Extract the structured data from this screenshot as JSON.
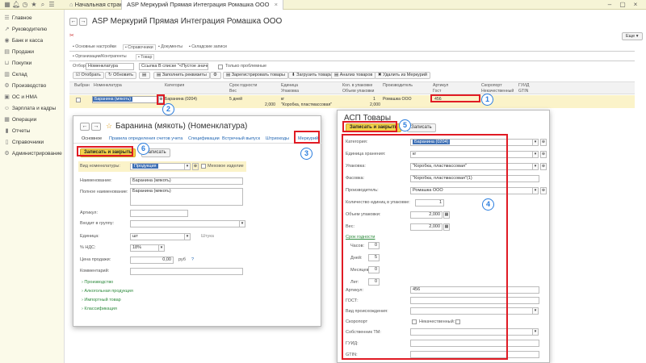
{
  "titlebar": {
    "tab_home": "Начальная страница",
    "tab_active": "ASP Меркурий Прямая Интеграция Ромашка ООО"
  },
  "sidebar": {
    "items": [
      {
        "label": "Главное",
        "icon": "menu-icon"
      },
      {
        "label": "Руководителю",
        "icon": "chart-icon"
      },
      {
        "label": "Банк и касса",
        "icon": "bank-icon"
      },
      {
        "label": "Продажи",
        "icon": "sales-icon"
      },
      {
        "label": "Покупки",
        "icon": "cart-icon"
      },
      {
        "label": "Склад",
        "icon": "warehouse-icon"
      },
      {
        "label": "Производство",
        "icon": "factory-icon"
      },
      {
        "label": "ОС и НМА",
        "icon": "assets-icon"
      },
      {
        "label": "Зарплата и кадры",
        "icon": "people-icon"
      },
      {
        "label": "Операции",
        "icon": "operations-icon"
      },
      {
        "label": "Отчеты",
        "icon": "reports-icon"
      },
      {
        "label": "Справочники",
        "icon": "catalogs-icon"
      },
      {
        "label": "Администрирование",
        "icon": "gear-icon"
      }
    ]
  },
  "main": {
    "title": "ASP Меркурий Прямая Интеграция Ромашка ООО",
    "more_label": "Еще",
    "tabs": [
      "Основные настройки",
      "Справочники",
      "Документы",
      "Складские записи"
    ],
    "subtabs": [
      "Организации/Контрагенты",
      "Товар"
    ],
    "filter": {
      "label": "Отбор",
      "field": "Номенклатура",
      "link_value": "Ссылка В списке \"<Пустое значение>...\"",
      "check_label": "Только проблемные"
    },
    "toolbar": [
      "Отобрать",
      "Обновить",
      "Заполнить реквизиты",
      "Зарегистрировать товары",
      "Загрузить товары",
      "Анализ товаров",
      "Удалить из Меркурий"
    ],
    "grid": {
      "headers1": [
        "Выбран",
        "Номенклатура",
        "Категория",
        "Срок годности",
        "Единица",
        "Кол. в упаковке",
        "Производитель",
        "Артикул",
        "Скоропорт",
        "ГУИД"
      ],
      "headers2": [
        "Вес",
        "Упаковка",
        "Объем упаковки",
        "Гост",
        "Некачественный",
        "GTIN"
      ],
      "row": {
        "nomenclature": "Баранина (мякоть)",
        "category": "Баранина (0204)",
        "shelf_life": "5 дней",
        "unit": "кг",
        "qty": "1",
        "producer": "Ромашка ООО",
        "article": "456",
        "weight": "2,000",
        "package": "\"Коробка, пластмассовая\"",
        "volume": "2,000"
      }
    }
  },
  "nomenclature_form": {
    "title": "Баранина (мякоть) (Номенклатура)",
    "tabs": [
      "Основное",
      "Правила определения счетов учета",
      "Спецификации",
      "Встречный выпуск",
      "Штрихкоды",
      "Меркурий"
    ],
    "save_close": "Записать и закрыть",
    "save": "Записать",
    "vid_label": "Вид номенклатуры:",
    "vid_value": "Продукция",
    "fur_label": "Меховое изделие",
    "fields": {
      "name_label": "Наименование:",
      "name_value": "Баранина (мякоть)",
      "full_label": "Полное наименование:",
      "full_value": "Баранина (мякоть)",
      "article_label": "Артикул:",
      "group_label": "Входит в группу:",
      "unit_label": "Единица:",
      "unit_value": "шт",
      "unit_hint": "Штука",
      "vat_label": "% НДС:",
      "vat_value": "18%",
      "price_label": "Цена продажи:",
      "price_value": "0,00",
      "price_currency": "руб",
      "price_help": "?",
      "comment_label": "Комментарий:"
    },
    "sections": [
      "Производство",
      "Алкогольная продукция",
      "Импортный товар",
      "Классификация"
    ]
  },
  "asp_form": {
    "title": "АСП Товары",
    "save_close": "Записать и закрыть",
    "save": "Записать",
    "category_label": "Категория:",
    "category_value": "Баранина (0204)",
    "storage_unit_label": "Единица хранения:",
    "storage_unit_value": "кг",
    "package_label": "Упаковка:",
    "package_value": "\"Коробка, пластмассовая\"",
    "packing_label": "Фасовка:",
    "packing_value": "\"Коробка, пластмассовая\"(1)",
    "producer_label": "Производитель:",
    "producer_value": "Ромашка ООО",
    "qty_label": "Количество единиц в упаковке:",
    "qty_value": "1",
    "volume_label": "Объем упаковки:",
    "volume_value": "2,000",
    "weight_label": "Вес:",
    "weight_value": "2,000",
    "shelf_link": "Срок годности",
    "hours_label": "Часов:",
    "hours_value": "0",
    "days_label": "Дней:",
    "days_value": "5",
    "months_label": "Месяцев:",
    "months_value": "0",
    "years_label": "Лет:",
    "years_value": "0",
    "article_label": "Артикул:",
    "article_value": "456",
    "gost_label": "ГОСТ:",
    "origin_label": "Вид происхождения:",
    "perishable_label": "Скоропорт",
    "defective_label": "Некачественный:",
    "tm_label": "Собственник ТМ:",
    "guid_label": "ГУИД:",
    "gtin_label": "GTIN:"
  },
  "annotations": [
    "1",
    "2",
    "3",
    "4",
    "5",
    "6"
  ],
  "colors": {
    "highlight_red": "#e01b24",
    "callout_blue": "#2a7dde",
    "save_yellow": "#f3d24a"
  }
}
